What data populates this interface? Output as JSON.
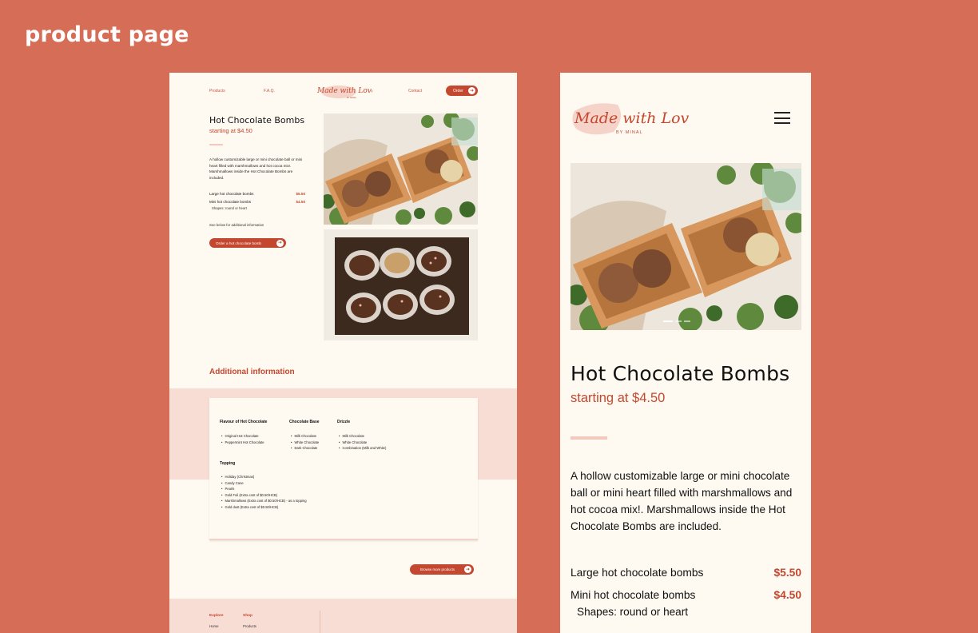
{
  "page_title": "product page",
  "desktop": {
    "nav": {
      "products": "Products",
      "faq": "F.A.Q.",
      "contact": "Contact",
      "order": "Order"
    },
    "product": {
      "title": "Hot Chocolate Bombs",
      "price": "starting at $4.50",
      "description": "A hollow customizable large or mini chocolate ball or mini heart filled with marshmallows and hot cocoa mix!. Marshmallows inside the Hot Chocolate Bombs are included.",
      "rows": [
        {
          "name": "Large hot chocolate bombs",
          "price": "$5.50"
        },
        {
          "name": "Mini hot chocolate bombs",
          "price": "$4.50"
        }
      ],
      "shapes": "Shapes: round or heart",
      "see_below": "See below for additional information",
      "cta": "Order a hot chocolate bomb"
    },
    "additional": {
      "heading": "Additional information",
      "flavour": {
        "title": "Flavour of Hot Chocolate",
        "items": [
          "Original Hot Chocolate",
          "Peppermint Hot Chocolate"
        ]
      },
      "base": {
        "title": "Chocolate Base",
        "items": [
          "Milk Chocolate",
          "White Chocolate",
          "Dark Chocolate"
        ]
      },
      "drizzle": {
        "title": "Drizzle",
        "items": [
          "Milk Chocolate",
          "White Chocolate",
          "Combination (Milk and White)"
        ]
      },
      "topping": {
        "title": "Topping",
        "items": [
          "Holiday (Christmas)",
          "Candy Cane",
          "Pearls",
          "Gold Foil (Extra cost of $0.50/HCB)",
          "Marshmallows (Extra cost of $0.50/HCB) - as a topping",
          "Gold dust (Extra cost of $0.50/HCB)"
        ]
      }
    },
    "browse": "Browse more products",
    "footer": {
      "explore": "Explore",
      "home": "Home",
      "shop": "Shop",
      "products": "Products"
    }
  },
  "mobile": {
    "title": "Hot Chocolate Bombs",
    "price": "starting at $4.50",
    "description": "A hollow customizable large or mini chocolate ball or mini heart filled with marshmallows and hot cocoa mix!. Marshmallows inside the Hot Chocolate Bombs are included.",
    "rows": [
      {
        "name": "Large hot chocolate bombs",
        "price": "$5.50"
      },
      {
        "name": "Mini hot chocolate bombs",
        "price": "$4.50"
      }
    ],
    "shapes": "Shapes: round or heart"
  },
  "logo": {
    "script": "Made with Love",
    "byline": "BY MINAL"
  },
  "colors": {
    "background": "#d66d56",
    "accent": "#c4472f",
    "cream": "#fefaf1",
    "blush": "#f8ddd4"
  },
  "icons": {
    "arrow": "arrow-right-icon",
    "menu": "hamburger-menu-icon"
  }
}
